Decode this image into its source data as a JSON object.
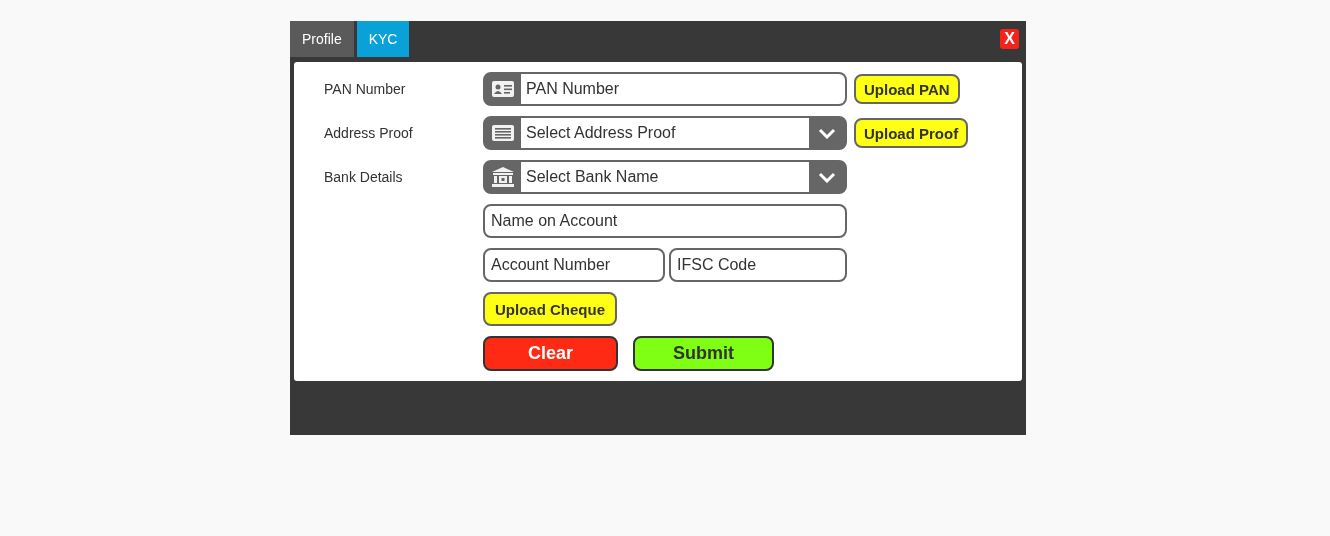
{
  "tabs": [
    {
      "label": "Profile",
      "selected": false
    },
    {
      "label": "KYC",
      "selected": true
    }
  ],
  "close_button": {
    "label": "X"
  },
  "rows": [
    {
      "label": "PAN Number",
      "kind": "text",
      "placeholder": "PAN Number",
      "upload": "Upload PAN"
    },
    {
      "label": "Address Proof",
      "kind": "select",
      "placeholder": "Select Address Proof",
      "upload": "Upload Proof"
    },
    {
      "label": "Bank Details",
      "kind": "select",
      "placeholder": "Select Bank Name"
    }
  ],
  "bank": {
    "name_on_account": {
      "placeholder": "Name on Account"
    },
    "account_number": {
      "placeholder": "Account Number"
    },
    "ifsc_code": {
      "placeholder": "IFSC Code"
    },
    "upload": "Upload Cheque"
  },
  "actions": {
    "clear": "Clear",
    "submit": "Submit"
  }
}
